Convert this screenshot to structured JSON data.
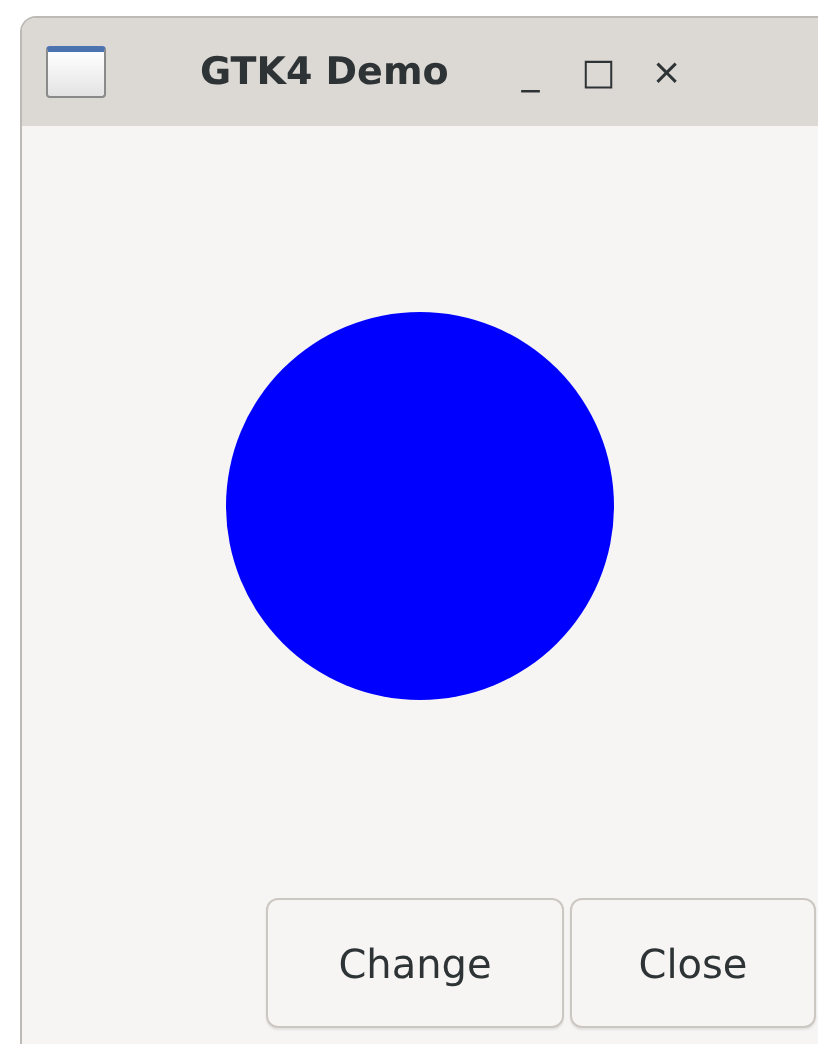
{
  "window": {
    "title": "GTK4 Demo",
    "controls": [
      "_",
      "□",
      "×"
    ]
  },
  "circle": {
    "color": "#0000ff"
  },
  "buttons": [
    "Change",
    "Close"
  ]
}
